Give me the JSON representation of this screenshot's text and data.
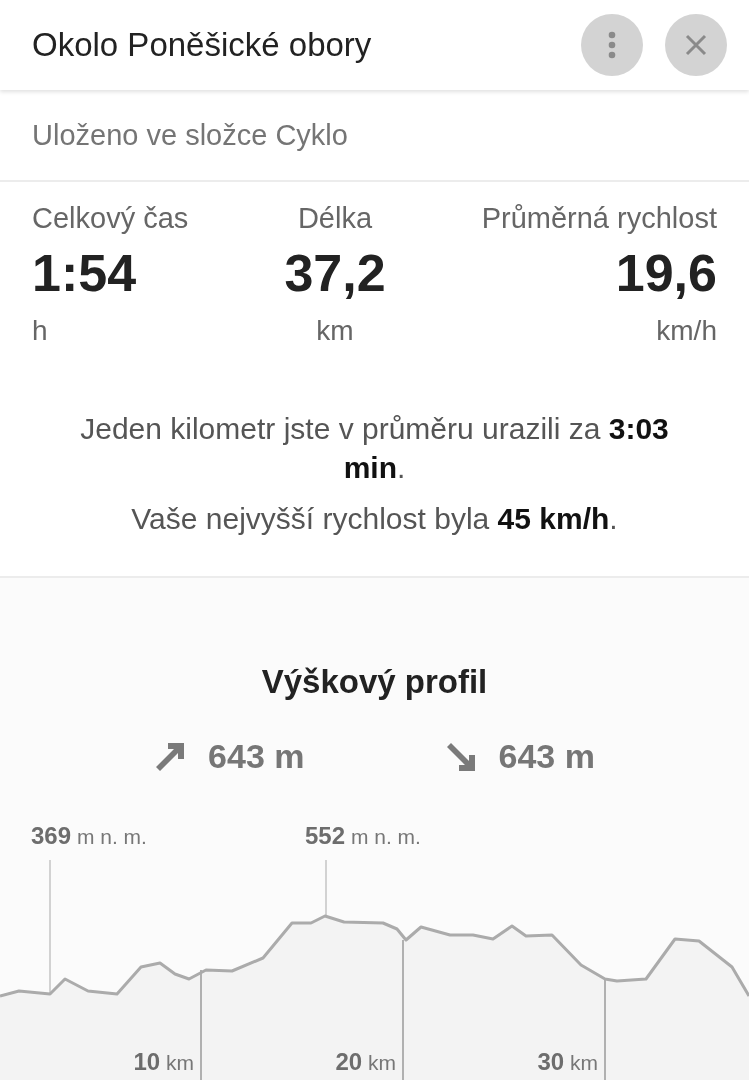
{
  "header": {
    "title": "Okolo Poněšické obory"
  },
  "folder": "Uloženo ve složce Cyklo",
  "stats": [
    {
      "label": "Celkový čas",
      "value": "1:54",
      "unit": "h"
    },
    {
      "label": "Délka",
      "value": "37,2",
      "unit": "km"
    },
    {
      "label": "Průměrná rychlost",
      "value": "19,6",
      "unit": "km/h"
    }
  ],
  "summary": [
    "Jeden kilometr jste v průměru urazili za **3:03 min**.",
    "Vaše nejvyšší rychlost byla **45 km/h**."
  ],
  "elevation": {
    "title": "Výškový profil",
    "gains": [
      {
        "kind": "ascent",
        "value": "643 m"
      },
      {
        "kind": "descent",
        "value": "643 m"
      }
    ],
    "markers": [
      {
        "value": "369",
        "unit": "m n. m."
      },
      {
        "value": "552",
        "unit": "m n. m."
      }
    ],
    "distance_ticks": [
      {
        "value": "10",
        "unit": "km"
      },
      {
        "value": "20",
        "unit": "km"
      },
      {
        "value": "30",
        "unit": "km"
      }
    ]
  }
}
